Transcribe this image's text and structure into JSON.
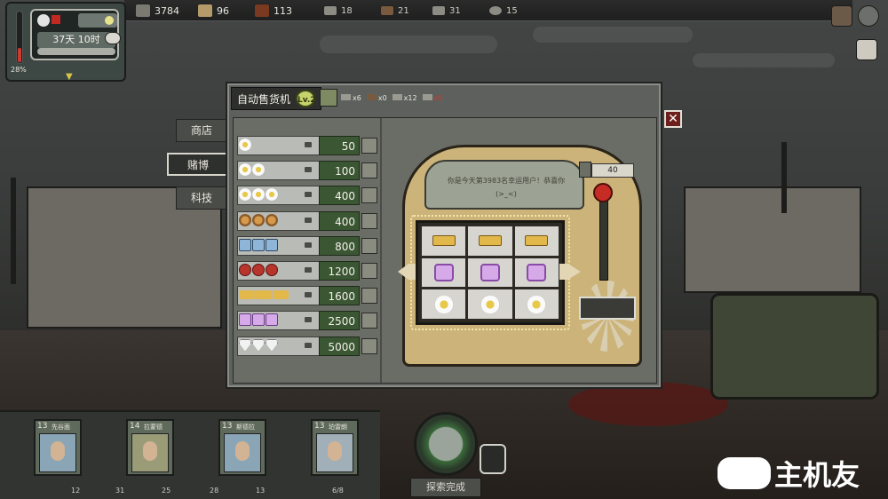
{
  "top_bar": {
    "resources": [
      {
        "name": "wood-icon",
        "value": "3784"
      },
      {
        "name": "cloth-icon",
        "value": "96"
      },
      {
        "name": "food-icon",
        "value": "113"
      }
    ],
    "materials": [
      {
        "name": "metal-icon",
        "value": "18"
      },
      {
        "name": "leather-icon",
        "value": "21"
      },
      {
        "name": "parts-icon",
        "value": "31"
      },
      {
        "name": "gear-icon",
        "value": "15"
      }
    ]
  },
  "clock_panel": {
    "temperature": "28%",
    "temperature_fraction": 0.28,
    "date": "37天 10时"
  },
  "dialog": {
    "title": "自动售货机",
    "level": "Lv.2",
    "costs": [
      {
        "icon": "metal-icon",
        "value": "x6"
      },
      {
        "icon": "leather-icon",
        "value": "x0"
      },
      {
        "icon": "parts-icon",
        "value": "x12"
      },
      {
        "icon": "gear-icon",
        "value": "x8",
        "warning": true
      }
    ],
    "close_label": "✕"
  },
  "tabs": [
    {
      "label": "商店",
      "active": false
    },
    {
      "label": "赌博",
      "active": true
    },
    {
      "label": "科技",
      "active": false
    }
  ],
  "prize_rows": [
    {
      "symbol": "daisy",
      "count": 1,
      "price": "50"
    },
    {
      "symbol": "daisy",
      "count": 2,
      "price": "100"
    },
    {
      "symbol": "daisy",
      "count": 3,
      "price": "400"
    },
    {
      "symbol": "coin",
      "count": 3,
      "price": "400"
    },
    {
      "symbol": "ice",
      "count": 3,
      "price": "800"
    },
    {
      "symbol": "bag",
      "count": 3,
      "price": "1200"
    },
    {
      "symbol": "gold",
      "count": 3,
      "price": "1600"
    },
    {
      "symbol": "gem",
      "count": 3,
      "price": "2500"
    },
    {
      "symbol": "dia",
      "count": 3,
      "price": "5000"
    }
  ],
  "slot_machine": {
    "message": "你是今天第3983名幸运用户！恭喜你",
    "message_sub": "(>_<)",
    "bet": "40",
    "reels": [
      [
        "gold",
        "gold",
        "gold"
      ],
      [
        "gem",
        "gem",
        "gem"
      ],
      [
        "daisy",
        "daisy",
        "daisy"
      ]
    ]
  },
  "survivors": [
    {
      "level": "13",
      "name": "先谷面"
    },
    {
      "level": "14",
      "name": "拉蒙德"
    },
    {
      "level": "13",
      "name": "斯德拉"
    },
    {
      "level": "13",
      "name": "珀雷朗"
    }
  ],
  "status_stats": [
    "12",
    "31",
    "25",
    "28",
    "13",
    "6/8"
  ],
  "explore_label": "探索完成",
  "watermark": "主机友"
}
